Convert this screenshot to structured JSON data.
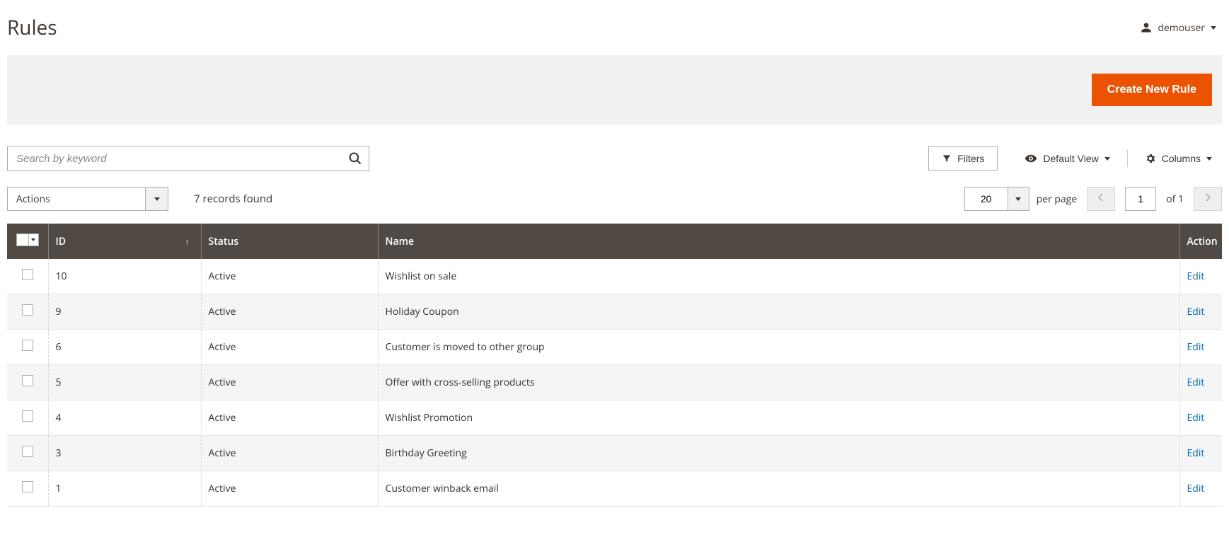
{
  "page": {
    "title": "Rules",
    "user": "demouser",
    "create_button": "Create New Rule"
  },
  "toolbar": {
    "search_placeholder": "Search by keyword",
    "filters_label": "Filters",
    "default_view_label": "Default View",
    "columns_label": "Columns",
    "actions_label": "Actions",
    "records_found": "7 records found",
    "per_page_value": "20",
    "per_page_label": "per page",
    "page_value": "1",
    "page_of": "of 1"
  },
  "table": {
    "headers": {
      "id": "ID",
      "status": "Status",
      "name": "Name",
      "action": "Action"
    },
    "rows": [
      {
        "id": "10",
        "status": "Active",
        "name": "Wishlist on sale",
        "action": "Edit"
      },
      {
        "id": "9",
        "status": "Active",
        "name": "Holiday Coupon",
        "action": "Edit"
      },
      {
        "id": "6",
        "status": "Active",
        "name": "Customer is moved to other group",
        "action": "Edit"
      },
      {
        "id": "5",
        "status": "Active",
        "name": "Offer with cross-selling products",
        "action": "Edit"
      },
      {
        "id": "4",
        "status": "Active",
        "name": "Wishlist Promotion",
        "action": "Edit"
      },
      {
        "id": "3",
        "status": "Active",
        "name": "Birthday Greeting",
        "action": "Edit"
      },
      {
        "id": "1",
        "status": "Active",
        "name": "Customer winback email",
        "action": "Edit"
      }
    ]
  }
}
